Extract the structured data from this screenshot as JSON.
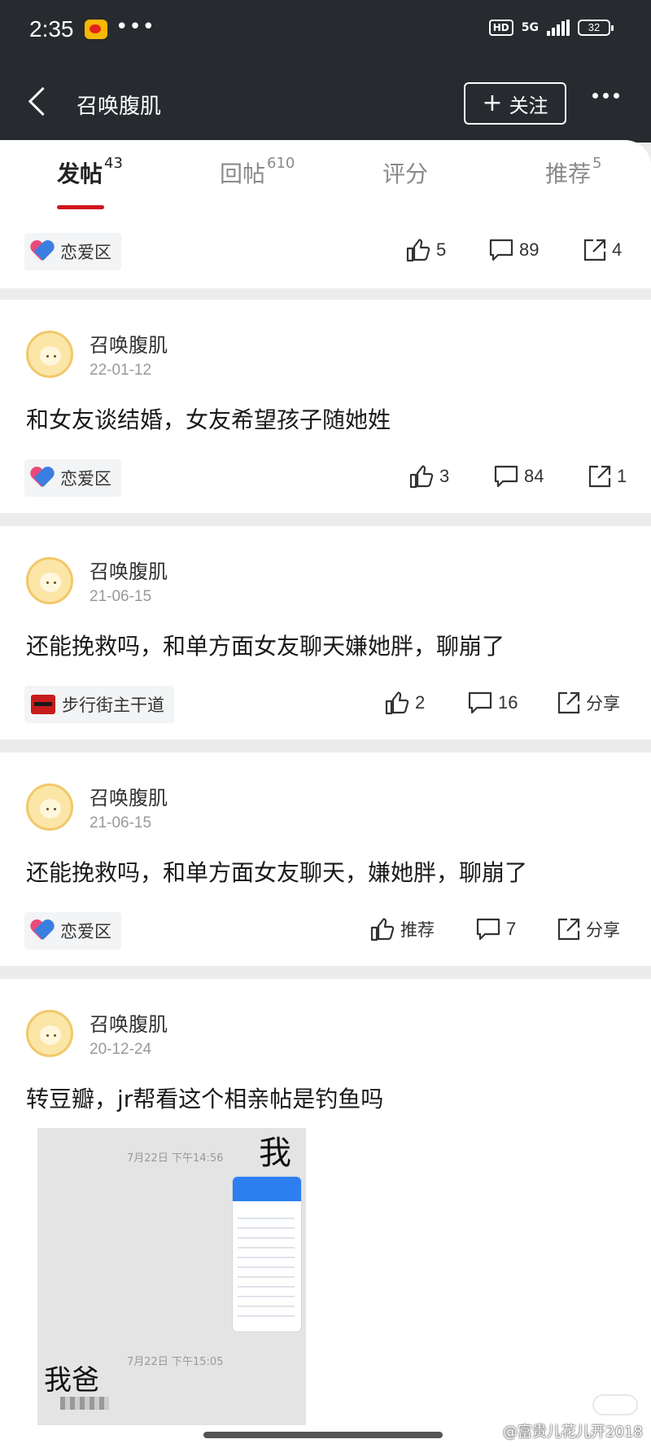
{
  "status_bar": {
    "time": "2:35",
    "network_badge": "HD",
    "network": "5G",
    "battery": "32"
  },
  "header": {
    "title": "召唤腹肌",
    "follow_label": "关注"
  },
  "tabs": [
    {
      "label": "发帖",
      "count": "43"
    },
    {
      "label": "回帖",
      "count": "610"
    },
    {
      "label": "评分",
      "count": ""
    },
    {
      "label": "推荐",
      "count": "5"
    }
  ],
  "posts": [
    {
      "tag": "恋爱区",
      "likes": "5",
      "comments": "89",
      "shares": "4"
    },
    {
      "author": "召唤腹肌",
      "date": "22-01-12",
      "title": "和女友谈结婚，女友希望孩子随她姓",
      "tag": "恋爱区",
      "likes": "3",
      "comments": "84",
      "shares": "1"
    },
    {
      "author": "召唤腹肌",
      "date": "21-06-15",
      "title": "还能挽救吗，和单方面女友聊天嫌她胖，聊崩了",
      "tag": "步行街主干道",
      "likes": "2",
      "comments": "16",
      "shares": "分享"
    },
    {
      "author": "召唤腹肌",
      "date": "21-06-15",
      "title": "还能挽救吗，和单方面女友聊天，嫌她胖，聊崩了",
      "tag": "恋爱区",
      "likes": "推荐",
      "comments": "7",
      "shares": "分享"
    },
    {
      "author": "召唤腹肌",
      "date": "20-12-24",
      "title": "转豆瓣，jr帮看这个相亲帖是钓鱼吗",
      "image": {
        "time1": "7月22日 下午14:56",
        "label1": "我",
        "time2": "7月22日 下午15:05",
        "label2": "我爸"
      }
    }
  ],
  "watermark": "@富贵儿花儿开2018"
}
